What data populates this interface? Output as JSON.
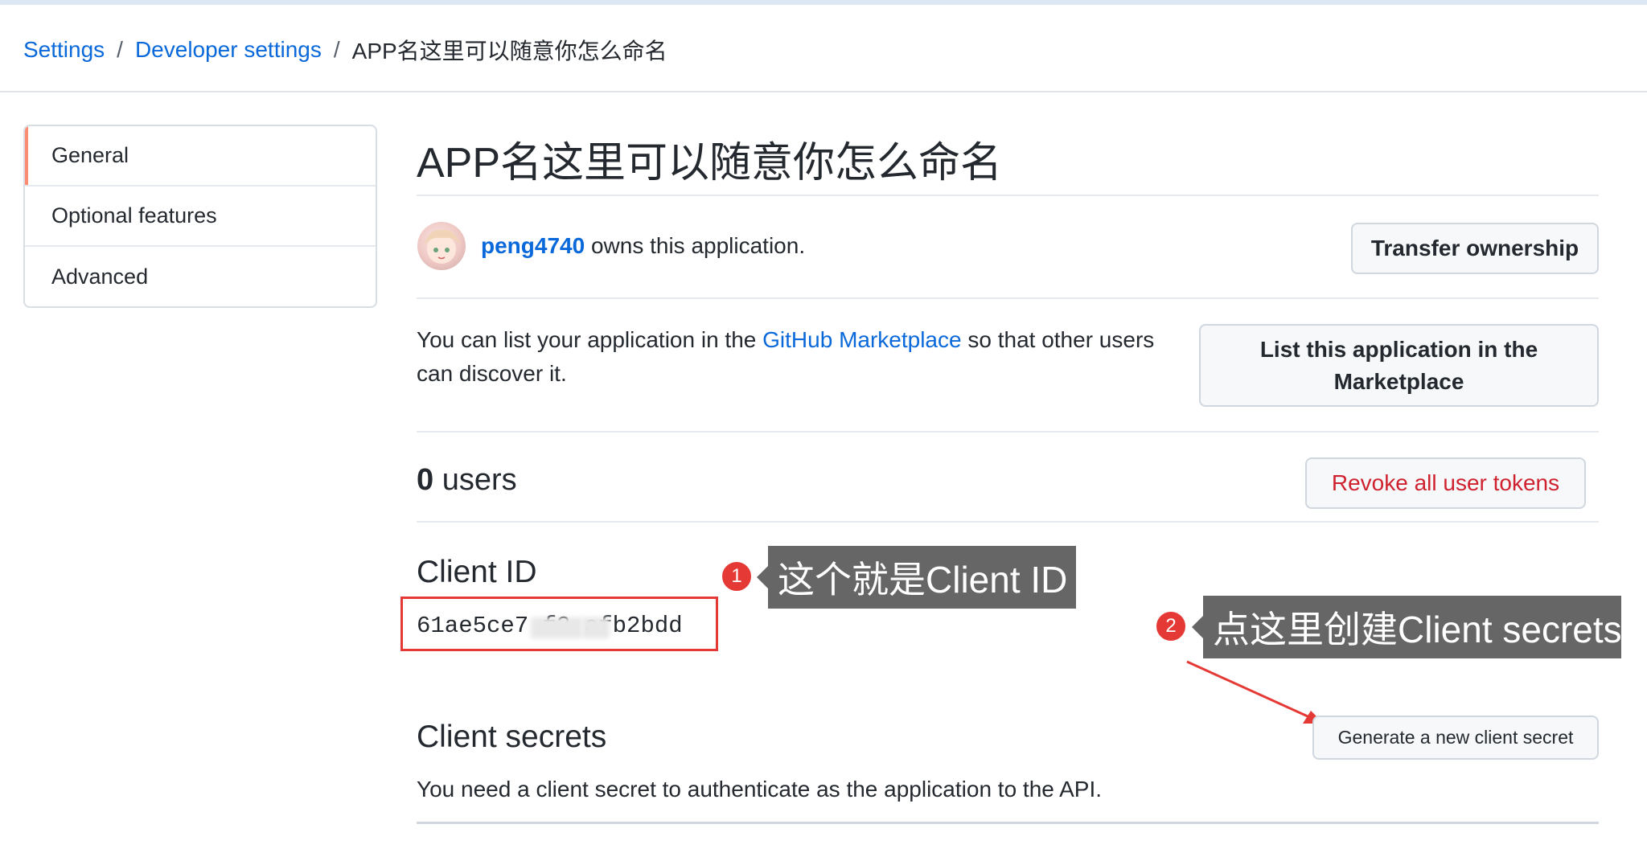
{
  "breadcrumb": {
    "items": [
      "Settings",
      "Developer settings"
    ],
    "separator": "/",
    "current": "APP名这里可以随意你怎么命名"
  },
  "sidebar": {
    "items": [
      {
        "label": "General",
        "selected": true
      },
      {
        "label": "Optional features"
      },
      {
        "label": "Advanced"
      }
    ]
  },
  "app": {
    "title": "APP名这里可以随意你怎么命名",
    "owner": {
      "username": "peng4740",
      "suffix": "owns this application."
    },
    "transfer_label": "Transfer ownership",
    "marketplace": {
      "text_before": "You can list your application in the",
      "link": "GitHub Marketplace",
      "text_after": "so that other users can discover it.",
      "button_label": "List this application in the Marketplace"
    },
    "users": {
      "count": "0",
      "label": "users",
      "revoke_label": "Revoke all user tokens"
    },
    "client_id": {
      "label": "Client ID",
      "value": "61ae5ce7   f3   afb2bdd"
    },
    "client_secrets": {
      "label": "Client secrets",
      "generate_label": "Generate a new client secret",
      "description": "You need a client secret to authenticate as the application to the API."
    }
  },
  "annotations": [
    {
      "number": "1",
      "text": "这个就是Client ID"
    },
    {
      "number": "2",
      "text": "点这里创建Client secrets"
    }
  ],
  "colors": {
    "link": "#0969da",
    "danger": "#cf222e",
    "annotation_red": "#e53935",
    "callout_bg": "#666666",
    "selected_marker": "#fd8c73"
  }
}
